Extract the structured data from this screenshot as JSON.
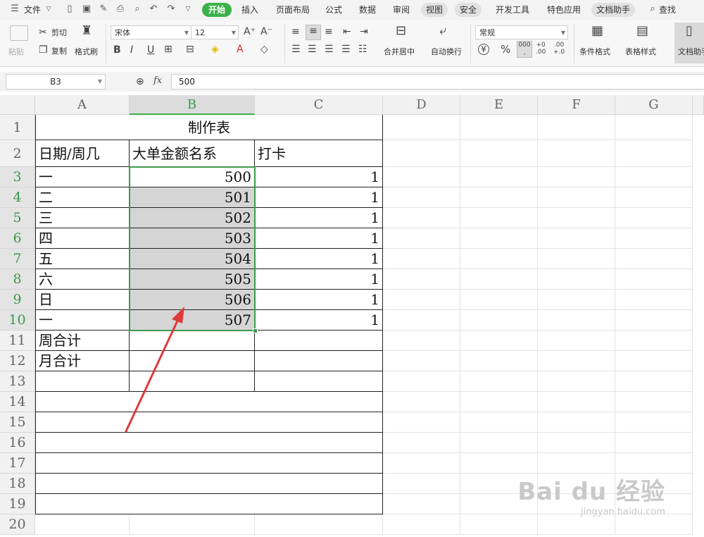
{
  "menu": {
    "file": "文件",
    "tabs": [
      "开始",
      "插入",
      "页面布局",
      "公式",
      "数据",
      "审阅",
      "视图",
      "安全",
      "开发工具",
      "特色应用",
      "文档助手"
    ],
    "active_tab": "开始",
    "search": "查找"
  },
  "ribbon": {
    "paste": "粘贴",
    "cut": "剪切",
    "copy": "复制",
    "format_painter": "格式刷",
    "font_name": "宋体",
    "font_size": "12",
    "merge_center": "合并居中",
    "wrap_text": "自动换行",
    "number_format": "常规",
    "conditional_format": "条件格式",
    "table_style": "表格样式",
    "doc_helper": "文档助手",
    "currency_symbol": "¥",
    "percent_symbol": "%",
    "thousands": "000",
    "inc_decimal_top": "+0",
    "inc_decimal_bottom": ".00",
    "dec_decimal_top": ".00",
    "dec_decimal_bottom": "+.0"
  },
  "formula_bar": {
    "name_box": "B3",
    "fx": "fx",
    "value": "500"
  },
  "grid": {
    "columns": [
      "A",
      "B",
      "C",
      "D",
      "E",
      "F",
      "G"
    ],
    "selected_column": "B",
    "rows": [
      "1",
      "2",
      "3",
      "4",
      "5",
      "6",
      "7",
      "8",
      "9",
      "10",
      "11",
      "12",
      "13",
      "14",
      "15",
      "16",
      "17",
      "18",
      "19",
      "20"
    ],
    "title": "制作表",
    "headers": [
      "日期/周几",
      "大单金额名系",
      "打卡"
    ],
    "data_rows": [
      {
        "day": "一",
        "amount": "500",
        "check": "1"
      },
      {
        "day": "二",
        "amount": "501",
        "check": "1"
      },
      {
        "day": "三",
        "amount": "502",
        "check": "1"
      },
      {
        "day": "四",
        "amount": "503",
        "check": "1"
      },
      {
        "day": "五",
        "amount": "504",
        "check": "1"
      },
      {
        "day": "六",
        "amount": "505",
        "check": "1"
      },
      {
        "day": "日",
        "amount": "506",
        "check": "1"
      },
      {
        "day": "一",
        "amount": "507",
        "check": "1"
      }
    ],
    "summary": [
      "周合计",
      "月合计"
    ]
  },
  "watermark": {
    "brand": "Bai du 经验",
    "url": "jingyan.baidu.com"
  },
  "colors": {
    "accent": "#3bb14a",
    "selection_border": "#3c9a4a",
    "selection_fill": "#d5d5d5",
    "arrow": "#e03a3a"
  }
}
